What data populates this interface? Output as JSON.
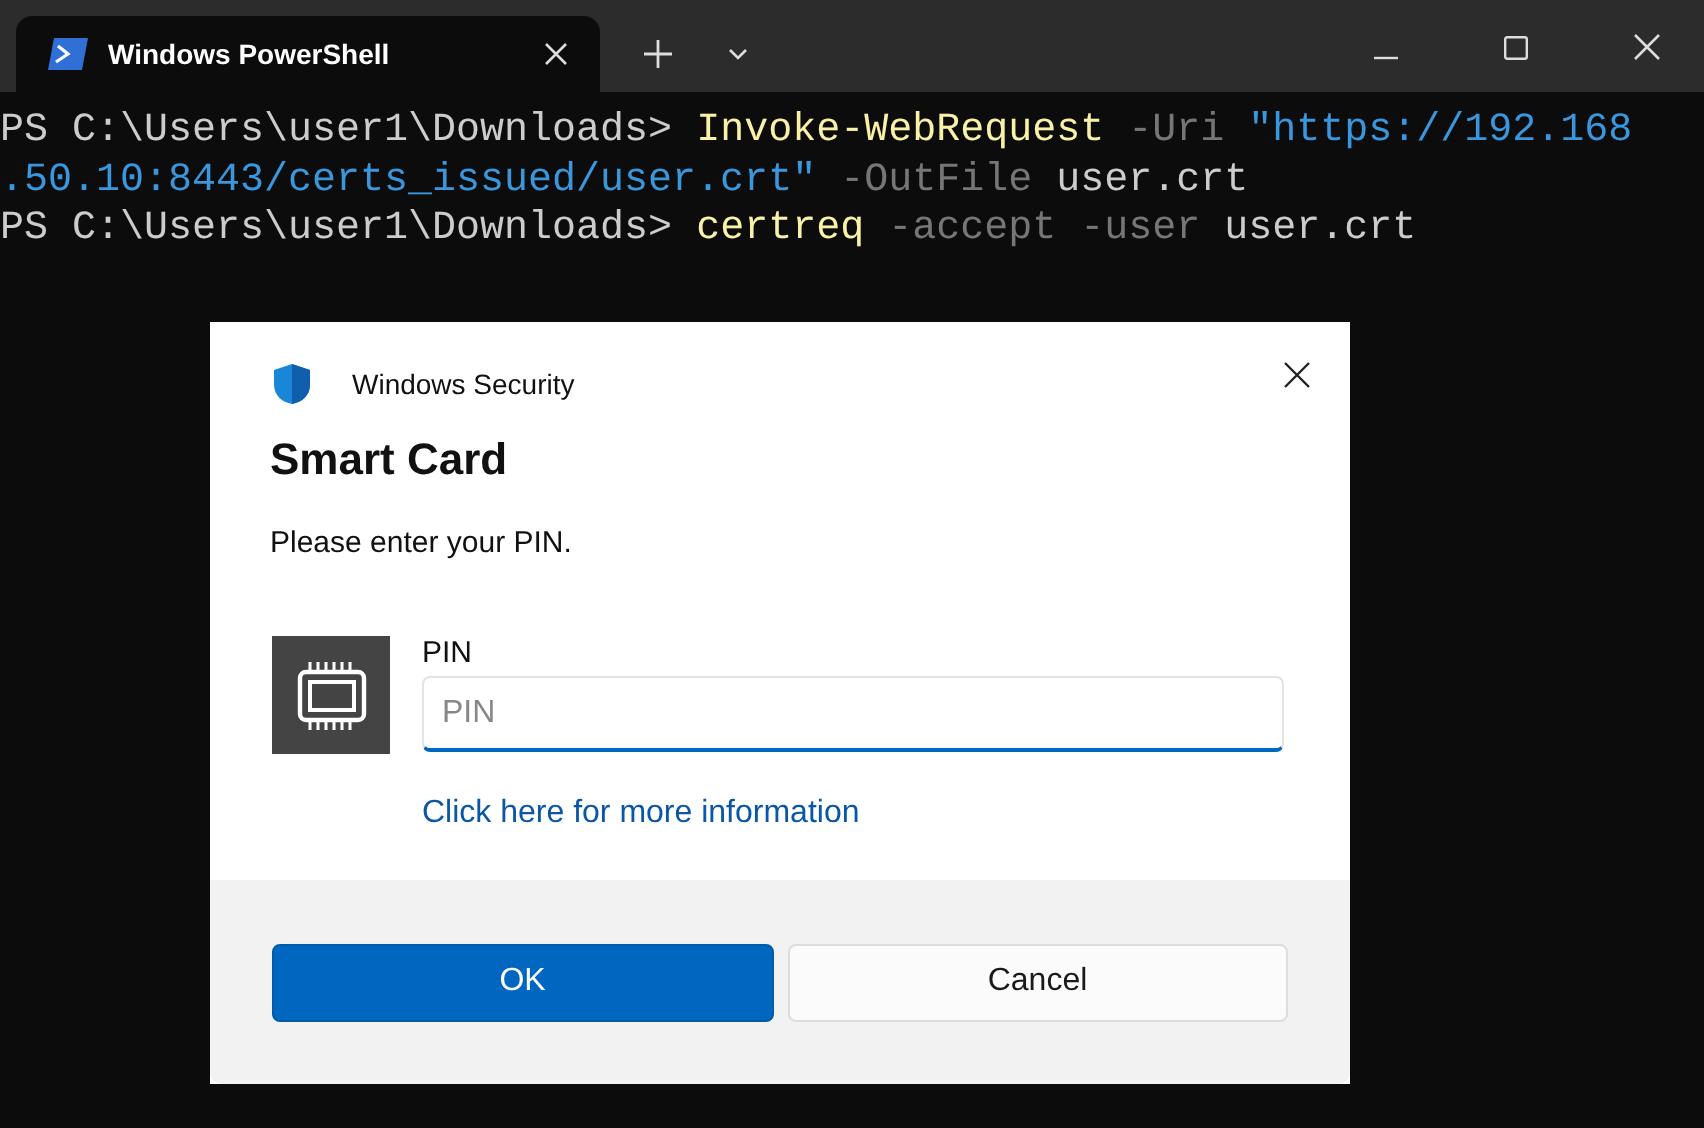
{
  "tab": {
    "title": "Windows PowerShell",
    "selected": true
  },
  "terminal": {
    "lines": [
      [
        {
          "kind": "prompt",
          "text": "PS C:\\Users\\user1\\Downloads> "
        },
        {
          "kind": "command",
          "text": "Invoke-WebRequest"
        },
        {
          "kind": "param",
          "text": " -Uri "
        },
        {
          "kind": "string",
          "text": "\"https://192.168"
        }
      ],
      [
        {
          "kind": "string",
          "text": ".50.10:8443/certs_issued/user.crt\""
        },
        {
          "kind": "param",
          "text": " -OutFile "
        },
        {
          "kind": "plain",
          "text": "user.crt"
        }
      ],
      [
        {
          "kind": "prompt",
          "text": "PS C:\\Users\\user1\\Downloads> "
        },
        {
          "kind": "command",
          "text": "certreq"
        },
        {
          "kind": "param",
          "text": " -accept -user "
        },
        {
          "kind": "plain",
          "text": "user.crt"
        }
      ]
    ]
  },
  "dialog": {
    "app": "Windows Security",
    "title": "Smart Card",
    "message": "Please enter your PIN.",
    "field_label": "PIN",
    "placeholder": "PIN",
    "link": "Click here for more information",
    "buttons": [
      {
        "label": "OK",
        "kind": "primary"
      },
      {
        "label": "Cancel",
        "kind": "secondary"
      }
    ]
  }
}
